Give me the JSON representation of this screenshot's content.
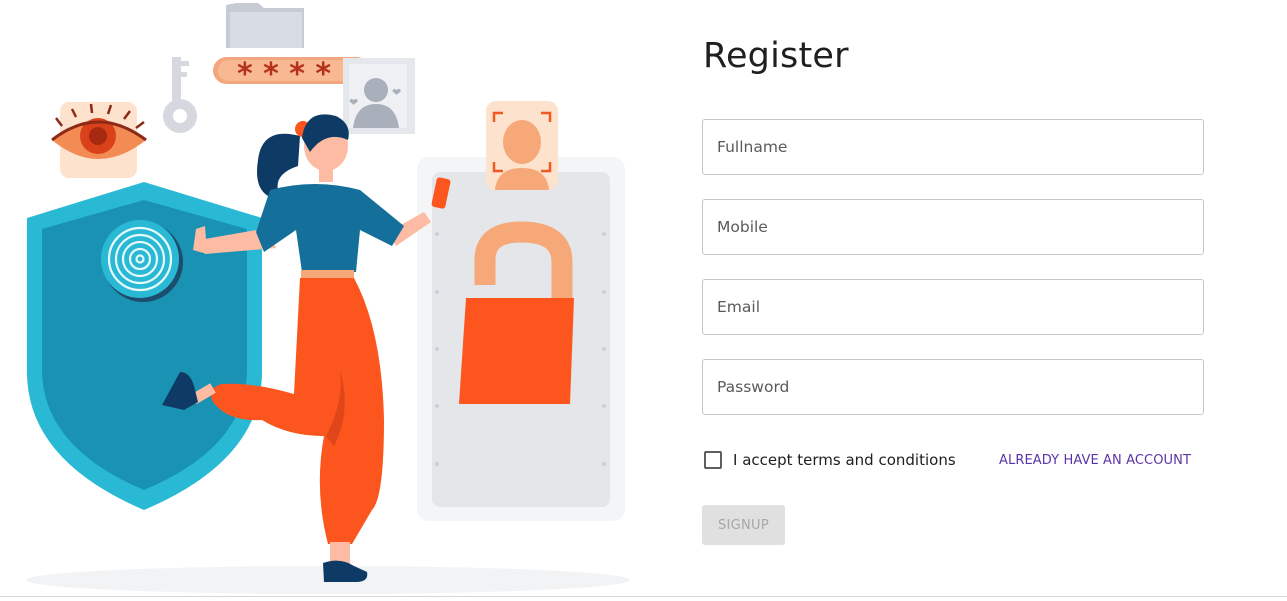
{
  "page": {
    "title": "Register"
  },
  "form": {
    "fields": [
      {
        "placeholder": "Fullname",
        "value": ""
      },
      {
        "placeholder": "Mobile",
        "value": ""
      },
      {
        "placeholder": "Email",
        "value": ""
      },
      {
        "placeholder": "Password",
        "value": ""
      }
    ],
    "terms_label": "I accept terms and conditions",
    "terms_checked": false,
    "login_link": "ALREADY HAVE AN ACCOUNT",
    "signup_label": "SIGNUP",
    "signup_enabled": false
  },
  "illustration": {
    "password_mask": "* * * *",
    "icons": [
      "eye-icon",
      "key-icon",
      "folder-icon",
      "profile-card-icon",
      "face-scan-icon",
      "fingerprint-icon",
      "padlock-icon",
      "shield-icon",
      "phone-icon"
    ]
  },
  "colors": {
    "accent": "#5b34a8",
    "orange": "#fc561e",
    "teal": "#1b93b6",
    "field_border": "#c6c6c6",
    "disabled_bg": "#e0e0e0",
    "disabled_text": "#a7a7a7"
  }
}
